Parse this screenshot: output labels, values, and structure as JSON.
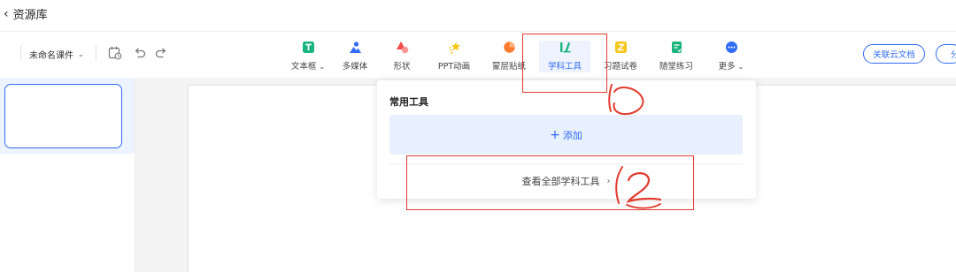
{
  "header": {
    "back_label": "资源库"
  },
  "toolbar": {
    "doc_name": "未命名课件",
    "tools": [
      {
        "label": "文本框",
        "icon": "text-box-icon",
        "color": "#19b47d",
        "dropdown": true
      },
      {
        "label": "多媒体",
        "icon": "multimedia-icon",
        "color": "#2f6bf3",
        "dropdown": false
      },
      {
        "label": "形状",
        "icon": "shape-icon",
        "color": "#f04a4a",
        "dropdown": false
      },
      {
        "label": "PPT动画",
        "icon": "ppt-animation-icon",
        "color": "#f5c518",
        "dropdown": false
      },
      {
        "label": "蒙层贴纸",
        "icon": "mask-sticker-icon",
        "color": "#ff7a2e",
        "dropdown": false
      },
      {
        "label": "学科工具",
        "icon": "subject-tools-icon",
        "color": "#19b47d",
        "dropdown": false,
        "active": true
      },
      {
        "label": "习题试卷",
        "icon": "exercise-paper-icon",
        "color": "#f5c518",
        "dropdown": false
      },
      {
        "label": "随堂练习",
        "icon": "class-practice-icon",
        "color": "#19b47d",
        "dropdown": false
      },
      {
        "label": "更多",
        "icon": "more-icon",
        "color": "#2f6bf3",
        "dropdown": true
      }
    ],
    "link_cloud_doc_label": "关联云文档",
    "share_label": "分"
  },
  "dropdown": {
    "title": "常用工具",
    "add_label": "添加",
    "view_all_label": "查看全部学科工具"
  },
  "annotations": {
    "one": "1",
    "two": "2",
    "color": "#e23a2e"
  },
  "colors": {
    "accent": "#2f6bf3"
  }
}
